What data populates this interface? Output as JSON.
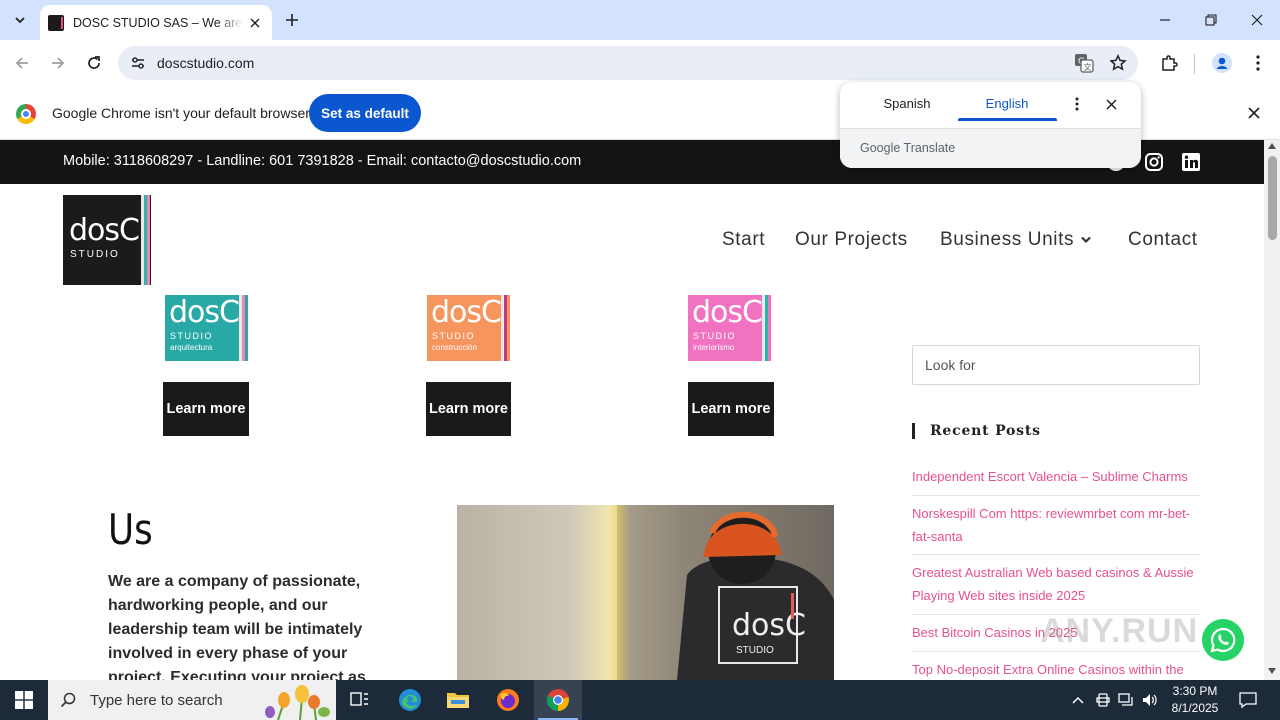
{
  "browser": {
    "tab_title": "DOSC STUDIO SAS – We are de",
    "url": "doscstudio.com",
    "infobar": {
      "message": "Google Chrome isn't your default browser",
      "button": "Set as default"
    },
    "translate_popup": {
      "source_lang": "Spanish",
      "target_lang": "English",
      "brand": "Google Translate",
      "active": "English"
    }
  },
  "site": {
    "contact_line": "Mobile: 3118608297 - Landline: 601 7391828 - Email: contacto@doscstudio.com",
    "logo": {
      "main": "dosC",
      "sub": "STUDIO"
    },
    "nav": [
      "Start",
      "Our Projects",
      "Business Units",
      "Contact"
    ],
    "units": [
      {
        "main": "dosC",
        "studio": "STUDIO",
        "sub": "arquitectura",
        "color": "#28a9a6",
        "button": "Learn more"
      },
      {
        "main": "dosC",
        "studio": "STUDIO",
        "sub": "construcción",
        "color": "#f6955e",
        "button": "Learn more"
      },
      {
        "main": "dosC",
        "studio": "STUDIO",
        "sub": "interiorismo",
        "color": "#f072c0",
        "button": "Learn more"
      }
    ],
    "search_placeholder": "Look for",
    "recent_posts_title": "Recent Posts",
    "recent_posts": [
      "Independent Escort Valencia – Sublime Charms",
      "Norskespill Com https: reviewmrbet com mr-bet-fat-santa",
      "Greatest Australian Web based casinos & Aussie Playing Web sites inside 2025",
      "Best Bitcoin Casinos in 2025",
      "Top No-deposit Extra Online Casinos within the"
    ],
    "us_title": "Us",
    "us_text": "We are a company of passionate, hardworking people, and our leadership team will be intimately involved in every phase of your project. Executing your project as effectively and",
    "photo_shirt": {
      "main": "dosC",
      "sub": "STUDIO"
    }
  },
  "watermark": "ANY.RUN",
  "taskbar": {
    "search_placeholder": "Type here to search",
    "time": "3:30 PM",
    "date": "8/1/2025"
  },
  "colors": {
    "brand_pink": "#e8508e",
    "chrome_blue": "#0b57d0",
    "tab_strip": "#d3e3fd",
    "taskbar": "#1c2a3a"
  }
}
